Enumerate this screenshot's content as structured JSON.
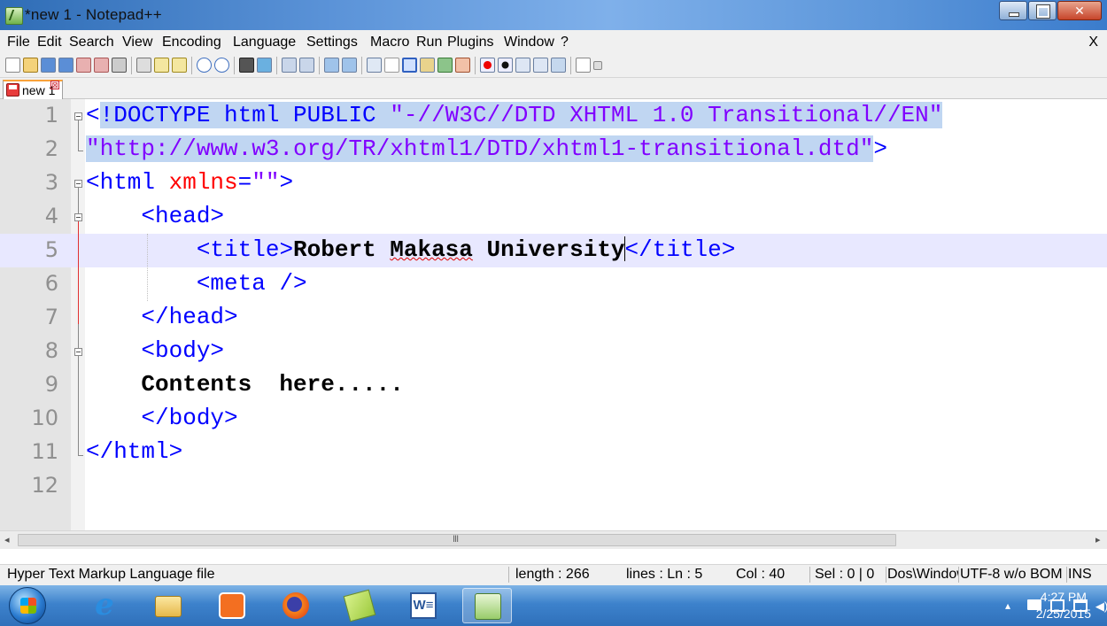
{
  "window": {
    "title": "*new  1 - Notepad++"
  },
  "menu": {
    "items": [
      "File",
      "Edit",
      "Search",
      "View",
      "Encoding",
      "Language",
      "Settings",
      "Macro",
      "Run",
      "Plugins",
      "Window",
      "?"
    ],
    "close": "X"
  },
  "tabs": [
    {
      "label": "new 1",
      "close": "⊠"
    }
  ],
  "editor": {
    "lines": [
      {
        "num": "1",
        "text": "<!DOCTYPE html PUBLIC \"-//W3C//DTD XHTML 1.0 Transitional//EN\""
      },
      {
        "num": "2",
        "text": "\"http://www.w3.org/TR/xhtml1/DTD/xhtml1-transitional.dtd\">"
      },
      {
        "num": "3",
        "text": "<html xmlns=\"\">"
      },
      {
        "num": "4",
        "text": "    <head>"
      },
      {
        "num": "5",
        "text": "        <title>Robert Makasa University</title>"
      },
      {
        "num": "6",
        "text": "        <meta />"
      },
      {
        "num": "7",
        "text": "    </head>"
      },
      {
        "num": "8",
        "text": "    <body>"
      },
      {
        "num": "9",
        "text": "    Contents  here....."
      },
      {
        "num": "10",
        "text": "    </body>"
      },
      {
        "num": "11",
        "text": "</html>"
      },
      {
        "num": "12",
        "text": ""
      }
    ],
    "current_line": 5
  },
  "hscroll": {
    "grip": "III",
    "left": "◂",
    "right": "▸"
  },
  "status": {
    "file_type": "Hyper Text Markup Language file",
    "length": "length : 266",
    "lines": "lines : Ln : 5",
    "col": "Col : 40",
    "sel": "Sel : 0 | 0",
    "eol": "Dos\\Windows",
    "encoding": "UTF-8 w/o BOM",
    "mode": "INS"
  },
  "taskbar": {
    "time": "4:27 PM",
    "date": "2/25/2015",
    "tray_arrow": "▴"
  },
  "colors": {
    "selection": "#c0d6f2",
    "current_line": "#e8e8ff",
    "tag": "#0000ff",
    "attribute": "#ff0000",
    "string": "#8000ff"
  }
}
